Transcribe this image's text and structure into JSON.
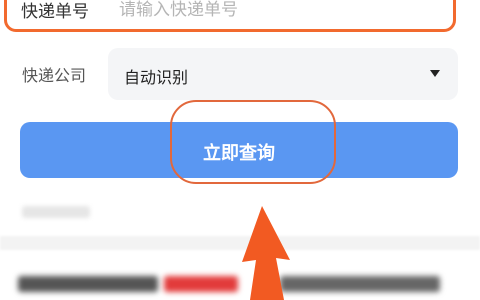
{
  "form": {
    "tracking_label": "快递单号",
    "tracking_placeholder": "请输入快递单号",
    "tracking_value": "",
    "company_label": "快递公司",
    "company_value": "自动识别",
    "query_button": "立即查询"
  },
  "colors": {
    "accent_blue": "#5a97f2",
    "highlight_orange": "#f26a2e",
    "arrow_orange": "#f25a22"
  },
  "icons": {
    "dropdown": "caret-down-icon",
    "annotation": "red-arrow-icon"
  }
}
